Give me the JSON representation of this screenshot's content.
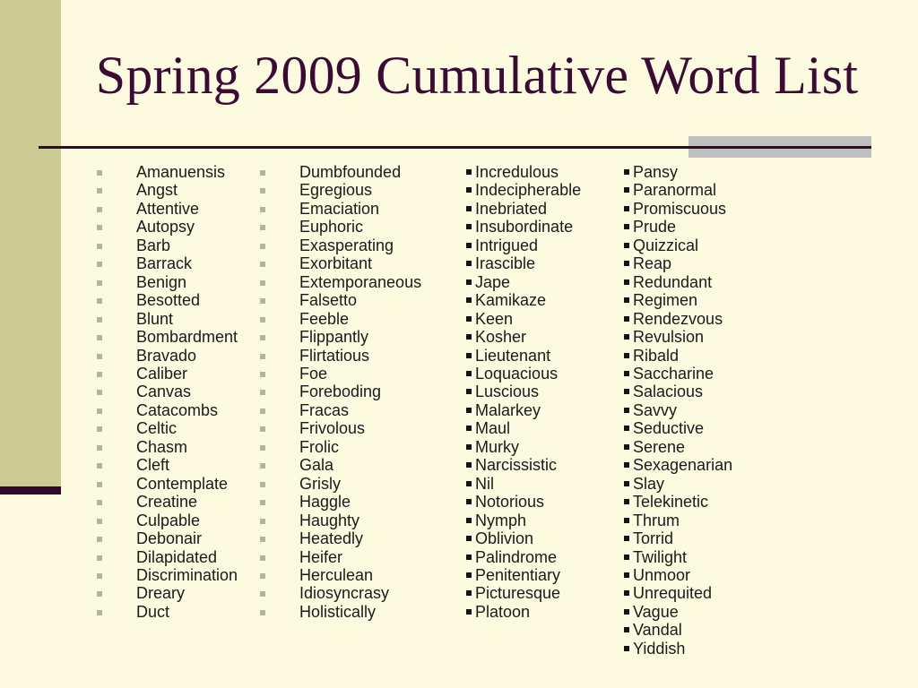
{
  "slide": {
    "title": "Spring 2009 Cumulative Word List",
    "background_color": "#FCFBDF",
    "title_color": "#3B0B35",
    "side_band_color": "#CCCB96",
    "side_band_foot_color": "#2F0A2B",
    "rule_color": "#2F0A2B",
    "grey_plate_color": "#BFBFBF",
    "bullet_color_grey": "#B4B49A",
    "bullet_color_black": "#141414",
    "text_color": "#1A1A1A"
  },
  "columns": [
    {
      "id": "column-1",
      "bullet_style": "grey-square-indented",
      "words": [
        "Amanuensis",
        "Angst",
        "Attentive",
        "Autopsy",
        "Barb",
        "Barrack",
        "Benign",
        "Besotted",
        "Blunt",
        "Bombardment",
        "Bravado",
        "Caliber",
        "Canvas",
        "Catacombs",
        "Celtic",
        "Chasm",
        "Cleft",
        "Contemplate",
        "Creatine",
        "Culpable",
        "Debonair",
        "Dilapidated",
        "Discrimination",
        "Dreary",
        "Duct"
      ]
    },
    {
      "id": "column-2",
      "bullet_style": "grey-square-indented",
      "words": [
        "Dumbfounded",
        "Egregious",
        "Emaciation",
        "Euphoric",
        "Exasperating",
        "Exorbitant",
        "Extemporaneous",
        "Falsetto",
        "Feeble",
        "Flippantly",
        "Flirtatious",
        "Foe",
        "Foreboding",
        "Fracas",
        "Frivolous",
        "Frolic",
        "Gala",
        "Grisly",
        "Haggle",
        "Haughty",
        "Heatedly",
        "Heifer",
        "Herculean",
        "Idiosyncrasy",
        "Holistically"
      ]
    },
    {
      "id": "column-3",
      "bullet_style": "black-square-tight",
      "words": [
        "Incredulous",
        "Indecipherable",
        "Inebriated",
        "Insubordinate",
        "Intrigued",
        "Irascible",
        "Jape",
        "Kamikaze",
        "Keen",
        "Kosher",
        "Lieutenant",
        "Loquacious",
        "Luscious",
        "Malarkey",
        "Maul",
        "Murky",
        "Narcissistic",
        "Nil",
        "Notorious",
        "Nymph",
        "Oblivion",
        "Palindrome",
        "Penitentiary",
        "Picturesque",
        "Platoon"
      ]
    },
    {
      "id": "column-4",
      "bullet_style": "black-square-tight",
      "words": [
        "Pansy",
        "Paranormal",
        "Promiscuous",
        "Prude",
        "Quizzical",
        "Reap",
        "Redundant",
        "Regimen",
        "Rendezvous",
        "Revulsion",
        "Ribald",
        "Saccharine",
        "Salacious",
        "Savvy",
        "Seductive",
        "Serene",
        "Sexagenarian",
        "Slay",
        "Telekinetic",
        "Thrum",
        "Torrid",
        "Twilight",
        "Unmoor",
        "Unrequited",
        "Vague",
        "Vandal",
        "Yiddish"
      ]
    }
  ]
}
